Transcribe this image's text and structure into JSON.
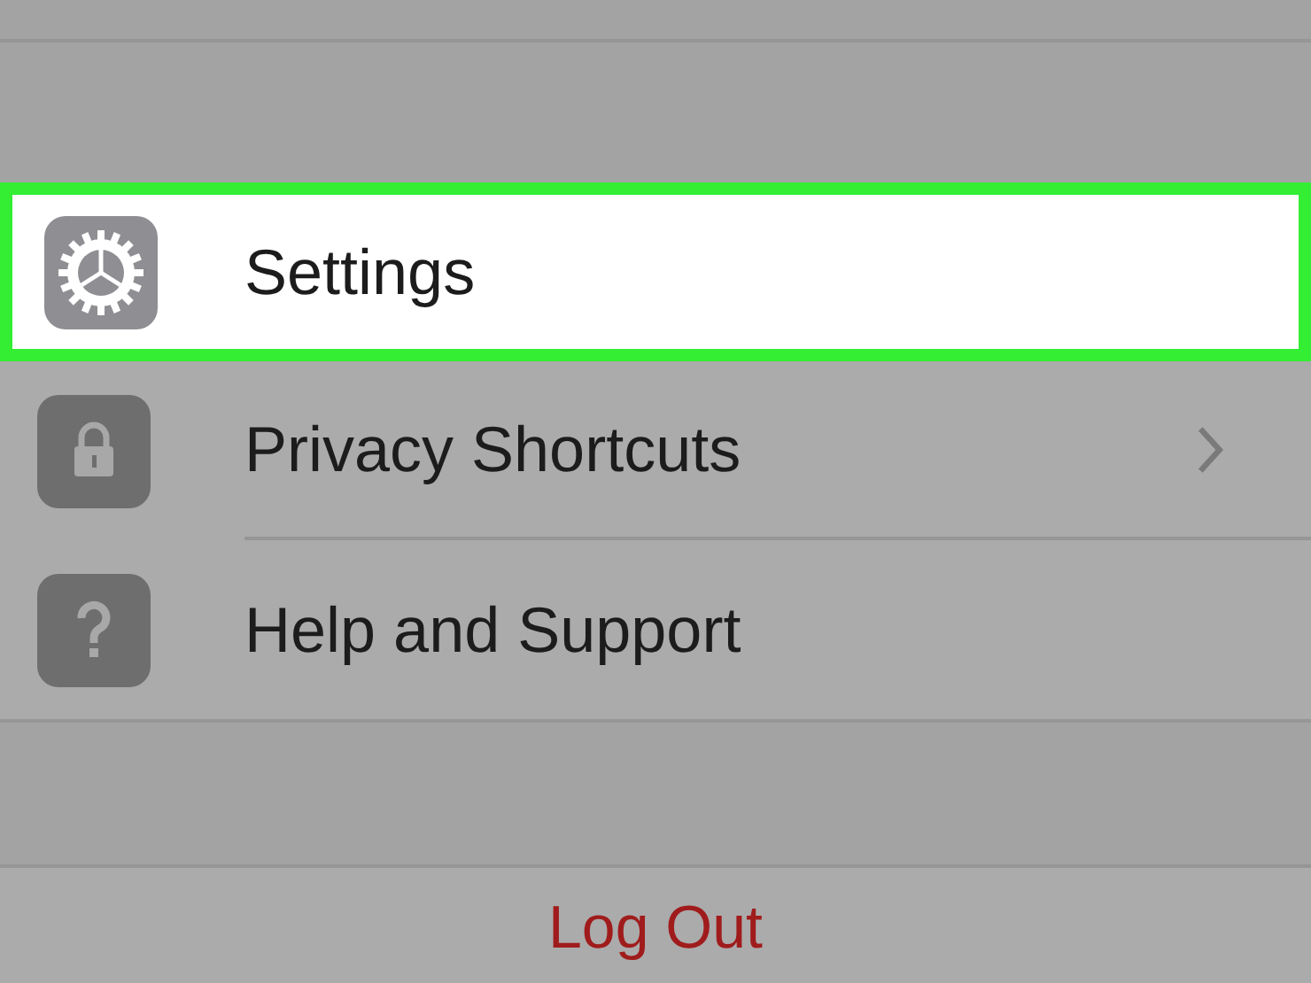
{
  "menu": {
    "items": [
      {
        "label": "Settings",
        "selected": true,
        "kind": "gear",
        "chevron": false
      },
      {
        "label": "Privacy Shortcuts",
        "selected": false,
        "kind": "lock",
        "chevron": true
      },
      {
        "label": "Help and Support",
        "selected": false,
        "kind": "question",
        "chevron": false
      }
    ]
  },
  "logout": {
    "label": "Log Out"
  }
}
